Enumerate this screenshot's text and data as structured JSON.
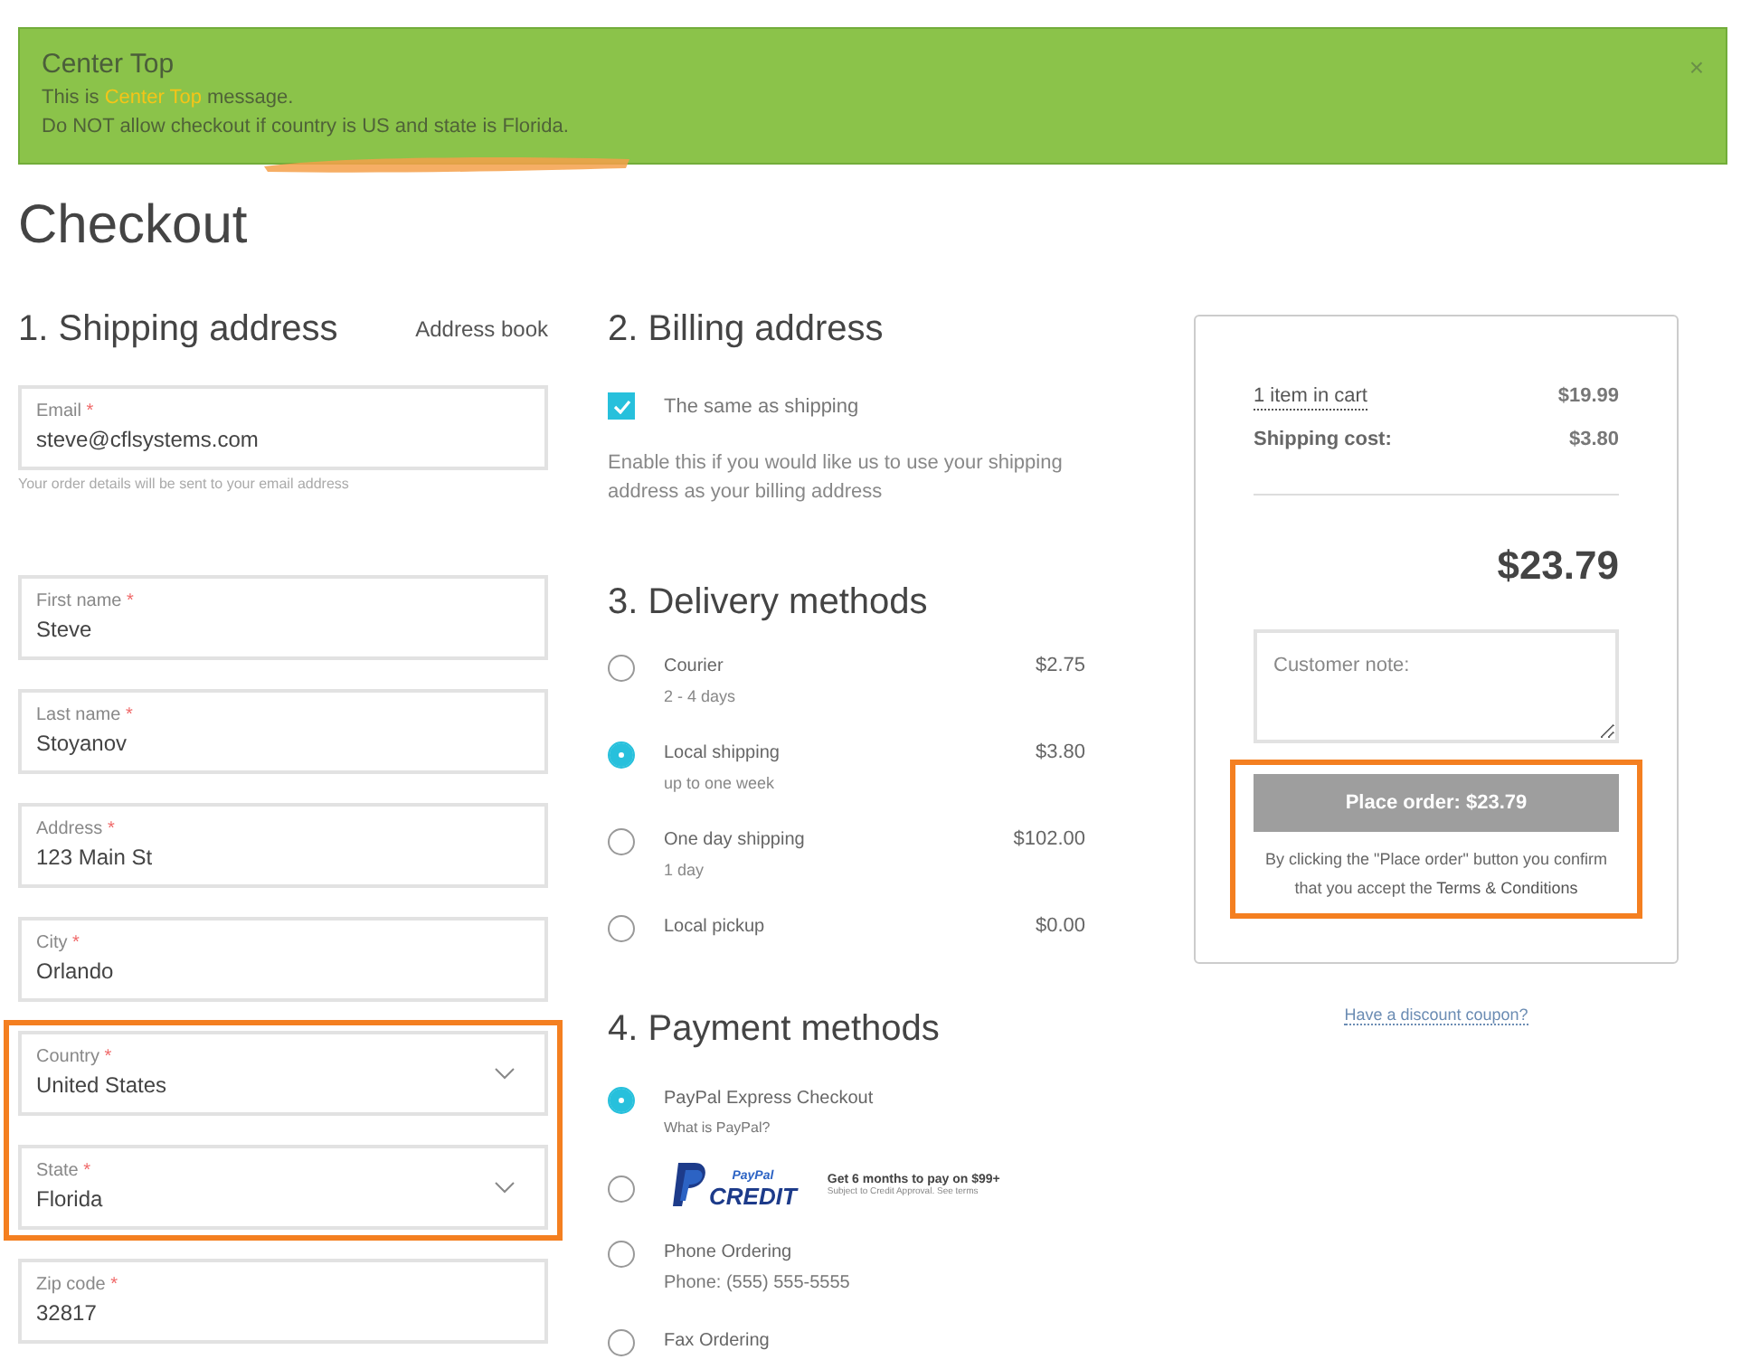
{
  "alert": {
    "title": "Center Top",
    "message": {
      "before": "This is ",
      "highlight": "Center Top",
      "after": " message."
    },
    "note": "Do NOT allow checkout if country is US and state is Florida.",
    "close": "×"
  },
  "page_title": "Checkout",
  "shipping": {
    "heading": "1. Shipping address",
    "address_book": "Address book",
    "fields": [
      {
        "kind": "text",
        "label": "Email",
        "required_mark": "*",
        "value": "steve@cflsystems.com",
        "hint": "Your order details will be sent to your email address"
      },
      {
        "kind": "text",
        "label": "First name",
        "required_mark": "*",
        "value": "Steve"
      },
      {
        "kind": "text",
        "label": "Last name",
        "required_mark": "*",
        "value": "Stoyanov"
      },
      {
        "kind": "text",
        "label": "Address",
        "required_mark": "*",
        "value": "123 Main St"
      },
      {
        "kind": "text",
        "label": "City",
        "required_mark": "*",
        "value": "Orlando"
      },
      {
        "kind": "callout",
        "fields": [
          {
            "kind": "select",
            "label": "Country",
            "required_mark": "*",
            "value": "United States"
          },
          {
            "kind": "select",
            "label": "State",
            "required_mark": "*",
            "value": "Florida"
          }
        ]
      },
      {
        "kind": "text",
        "label": "Zip code",
        "required_mark": "*",
        "value": "32817"
      }
    ]
  },
  "billing": {
    "heading": "2. Billing address",
    "same_as_shipping": {
      "label": "The same as shipping",
      "checked": true
    },
    "description": "Enable this if you would like us to use your shipping address as your billing address"
  },
  "delivery": {
    "heading": "3. Delivery methods",
    "methods": [
      {
        "name": "Courier",
        "detail": "2 - 4 days",
        "price": "$2.75",
        "selected": false
      },
      {
        "name": "Local shipping",
        "detail": "up to one week",
        "price": "$3.80",
        "selected": true
      },
      {
        "name": "One day shipping",
        "detail": "1 day",
        "price": "$102.00",
        "selected": false
      },
      {
        "name": "Local pickup",
        "price": "$0.00",
        "selected": false
      }
    ]
  },
  "payment": {
    "heading": "4. Payment methods",
    "methods": [
      {
        "kind": "text",
        "name": "PayPal Express Checkout",
        "link": "What is PayPal?",
        "selected": true
      },
      {
        "kind": "paypal-credit",
        "logo_top": "PayPal",
        "logo_bottom": "CREDIT",
        "promo": "Get 6 months to pay on $99+",
        "fine_print": "Subject to Credit Approval. See terms",
        "selected": false
      },
      {
        "kind": "text",
        "name": "Phone Ordering",
        "detail": "Phone: (555) 555-5555",
        "selected": false
      },
      {
        "kind": "text",
        "name": "Fax Ordering",
        "selected": false
      }
    ]
  },
  "summary": {
    "items_link": "1 item in cart",
    "items_total": "$19.99",
    "shipping_label": "Shipping cost:",
    "shipping_value": "$3.80",
    "total": "$23.79",
    "note_placeholder": "Customer note:",
    "order_block": {
      "kind": "callout",
      "place_order": {
        "label": "Place order: $23.79",
        "disabled": true
      },
      "terms_text": "By clicking the \"Place order\" button you confirm that you accept the ",
      "terms_link": "Terms & Conditions"
    },
    "coupon_link": "Have a discount coupon?"
  }
}
